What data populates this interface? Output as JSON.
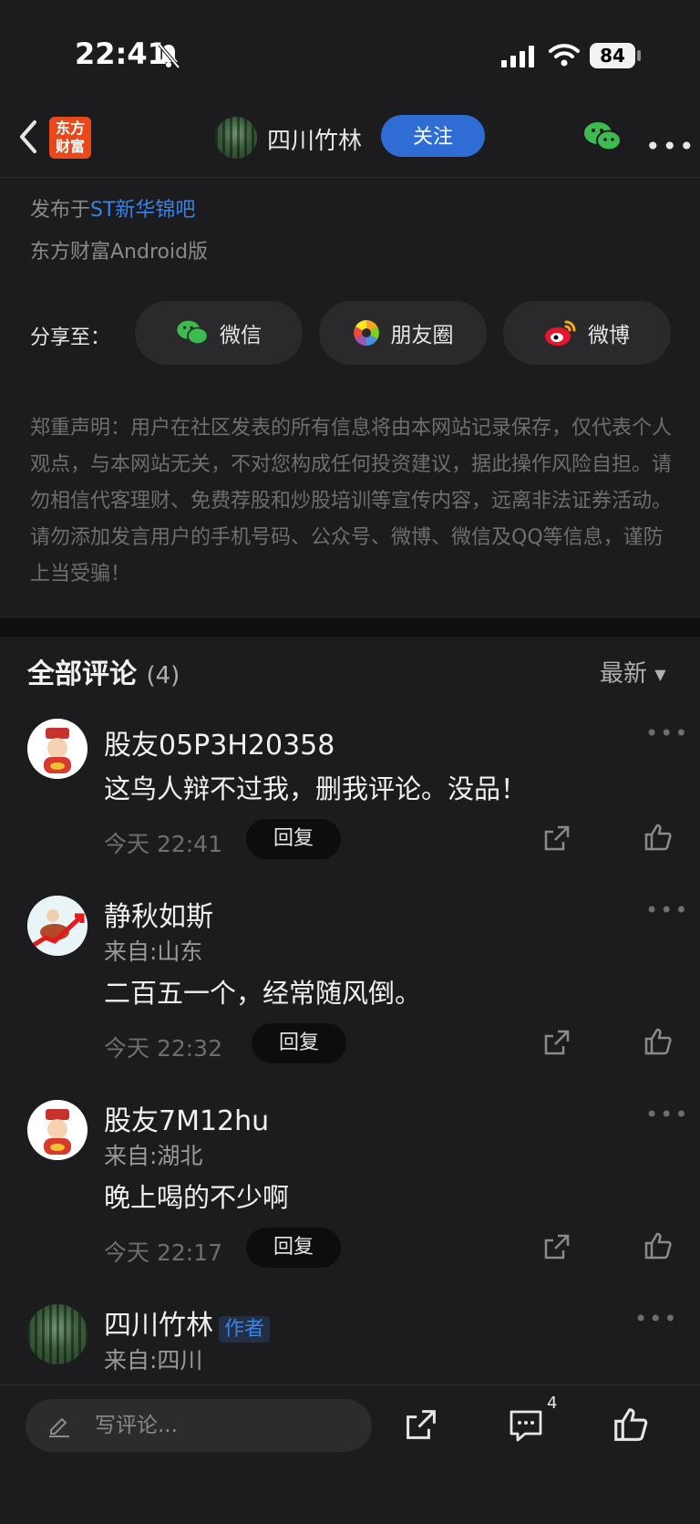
{
  "status_bar": {
    "time": "22:41",
    "battery": "84"
  },
  "nav": {
    "logo_line1": "东方",
    "logo_line2": "财富",
    "author_name": "四川竹林",
    "follow_label": "关注"
  },
  "post_meta": {
    "published_prefix": "发布于",
    "forum_link": "ST新华锦吧",
    "platform": "东方财富Android版"
  },
  "share": {
    "label": "分享至：",
    "buttons": [
      {
        "label": "微信",
        "icon": "wechat-icon"
      },
      {
        "label": "朋友圈",
        "icon": "moments-icon"
      },
      {
        "label": "微博",
        "icon": "weibo-icon"
      }
    ]
  },
  "disclaimer": "郑重声明：用户在社区发表的所有信息将由本网站记录保存，仅代表个人观点，与本网站无关，不对您构成任何投资建议，据此操作风险自担。请勿相信代客理财、免费荐股和炒股培训等宣传内容，远离非法证券活动。请勿添加发言用户的手机号码、公众号、微博、微信及QQ等信息，谨防上当受骗！",
  "comments": {
    "title": "全部评论",
    "count": "(4)",
    "sort_label": "最新",
    "items": [
      {
        "name": "股友05P3H20358",
        "location": "",
        "text": "这鸟人辩不过我，删我评论。没品！",
        "time": "今天 22:41",
        "reply": "回复"
      },
      {
        "name": "静秋如斯",
        "location": "来自:山东",
        "text": "二百五一个，经常随风倒。",
        "time": "今天 22:32",
        "reply": "回复"
      },
      {
        "name": "股友7M12hu",
        "location": "来自:湖北",
        "text": "晚上喝的不少啊",
        "time": "今天 22:17",
        "reply": "回复"
      },
      {
        "name": "四川竹林",
        "badge": "作者",
        "location": "来自:四川"
      }
    ]
  },
  "bottom_bar": {
    "input_placeholder": "写评论...",
    "comment_count": "4"
  },
  "colors": {
    "accent": "#2f6dd4",
    "link": "#3b82e6",
    "background": "#1c1c1e"
  }
}
